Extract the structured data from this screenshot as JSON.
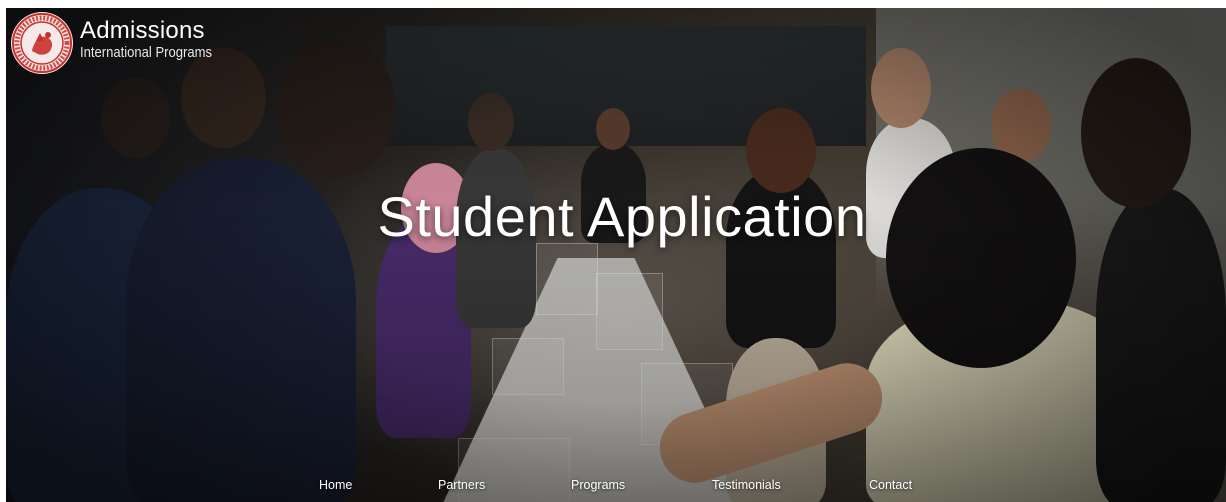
{
  "brand": {
    "title": "Admissions",
    "subtitle": "International Programs",
    "seal_icon": "university-seal-icon",
    "seal_color": "#c8302c"
  },
  "hero": {
    "title": "Student Application"
  },
  "nav": {
    "items": [
      {
        "label": "Home"
      },
      {
        "label": "Partners"
      },
      {
        "label": "Programs"
      },
      {
        "label": "Testimonials"
      },
      {
        "label": "Contact"
      }
    ]
  },
  "colors": {
    "text": "#ffffff",
    "backdrop": "#1c1a19"
  }
}
